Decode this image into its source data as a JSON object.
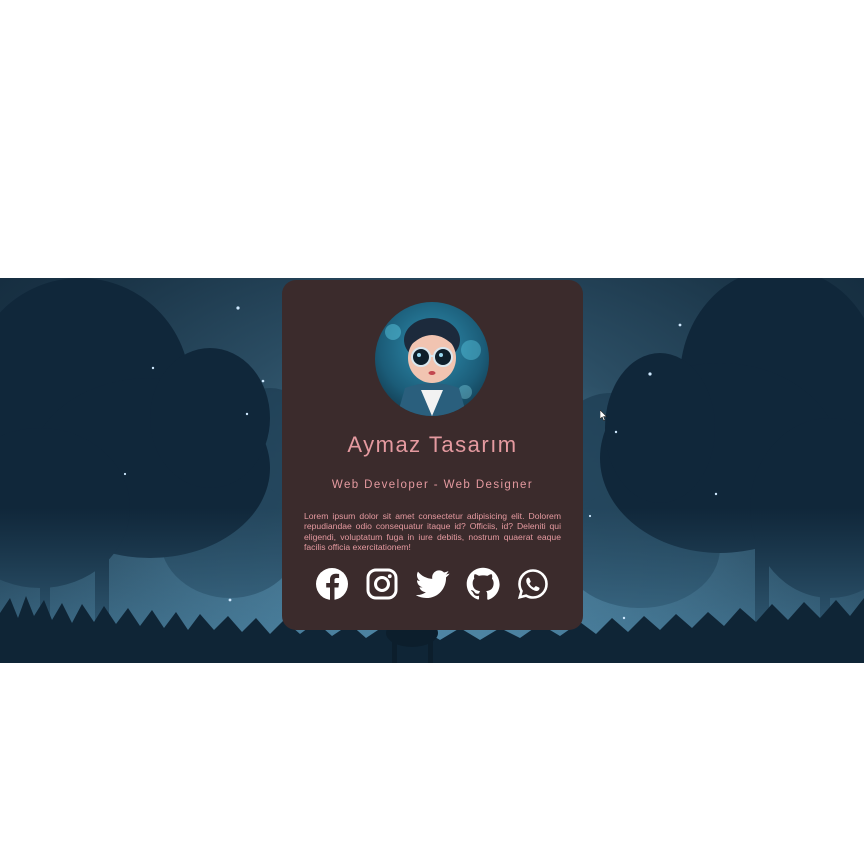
{
  "profile": {
    "name": "Aymaz Tasarım",
    "title": "Web Developer - Web Designer",
    "bio": "Lorem ipsum dolor sit amet consectetur adipisicing elit. Dolorem repudiandae odio consequatur itaque id? Officiis, id? Deleniti qui eligendi, voluptatum fuga in iure debitis, nostrum quaerat eaque facilis officia exercitationem!"
  },
  "socials": [
    {
      "icon": "facebook-icon"
    },
    {
      "icon": "instagram-icon"
    },
    {
      "icon": "twitter-icon"
    },
    {
      "icon": "github-icon"
    },
    {
      "icon": "whatsapp-icon"
    }
  ],
  "colors": {
    "card_background": "#3b2b2c",
    "accent_text": "#e59aa0",
    "icon": "#ffffff",
    "page_background": "#ffffff"
  }
}
